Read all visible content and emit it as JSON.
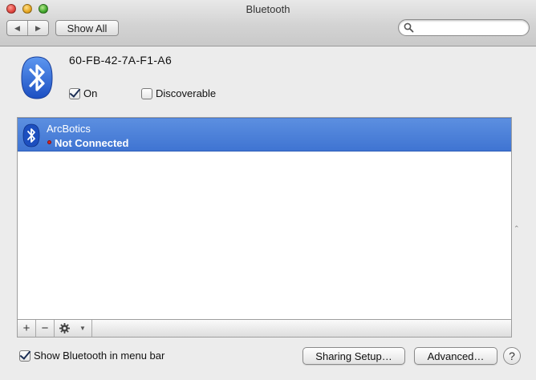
{
  "window": {
    "title": "Bluetooth"
  },
  "toolbar": {
    "back_glyph": "◀",
    "forward_glyph": "▶",
    "show_all_label": "Show All",
    "search_placeholder": "",
    "search_value": ""
  },
  "device": {
    "address": "60-FB-42-7A-F1-A6",
    "on_label": "On",
    "on_checked": true,
    "discoverable_label": "Discoverable",
    "discoverable_checked": false
  },
  "devices_list": [
    {
      "name": "ArcBotics",
      "status": "Not Connected",
      "selected": true,
      "status_color": "#d9241f"
    }
  ],
  "list_controls": {
    "add": "+",
    "remove": "−",
    "gear_arrow": "▼"
  },
  "footer": {
    "menu_bar_label": "Show Bluetooth in menu bar",
    "menu_bar_checked": true,
    "sharing_label": "Sharing Setup…",
    "advanced_label": "Advanced…",
    "help_label": "?"
  },
  "colors": {
    "bluetooth_blue": "#2b66d9",
    "selection": "#3f74d2"
  },
  "icons": [
    "bluetooth-icon",
    "search-icon",
    "gear-icon"
  ]
}
